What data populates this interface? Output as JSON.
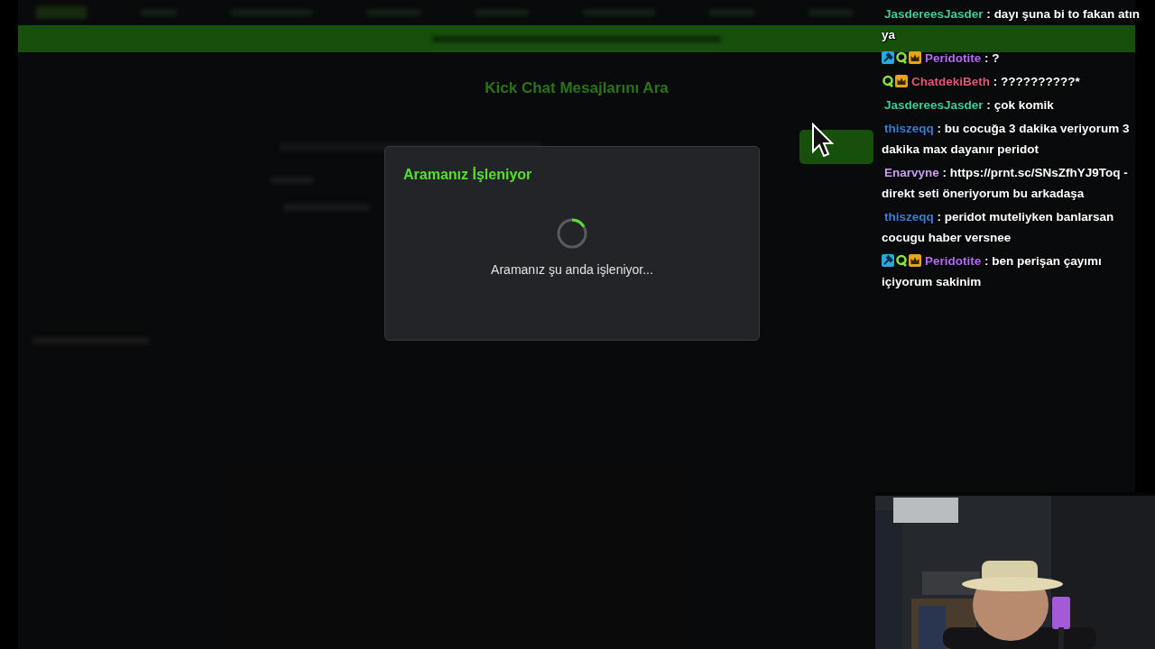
{
  "page": {
    "heading": "Kick Chat Mesajlarını Ara"
  },
  "modal": {
    "title": "Aramanız İşleniyor",
    "message": "Aramanız şu anda işleniyor..."
  },
  "chat": [
    {
      "user": "JasdereesJasder",
      "color": "#3fcf9c",
      "separator": ":",
      "text": "dayı şuna bi to fakan atın ya"
    },
    {
      "badges": [
        {
          "kind": "moderator"
        },
        {
          "kind": "vip"
        },
        {
          "kind": "subscriber"
        }
      ],
      "user": "Peridotite",
      "color": "#b46cf5",
      "separator": ":",
      "text": "?"
    },
    {
      "badges": [
        {
          "kind": "vip"
        },
        {
          "kind": "subscriber"
        }
      ],
      "user": "ChatdekiBeth",
      "color": "#e0587a",
      "separator": ":",
      "text": "??????????*"
    },
    {
      "user": "JasdereesJasder",
      "color": "#3fcf9c",
      "separator": ":",
      "text": "çok komik"
    },
    {
      "user": "thiszeqq",
      "color": "#3a7ed8",
      "separator": ":",
      "text": "bu cocuğa 3 dakika veriyorum 3 dakika max dayanır peridot"
    },
    {
      "user": "Enarvyne",
      "color": "#c9a2ee",
      "separator": ":",
      "text": "https://prnt.sc/SNsZfhYJ9Toq - direkt seti öneriyorum bu arkadaşa"
    },
    {
      "user": "thiszeqq",
      "color": "#3a7ed8",
      "separator": ":",
      "text": "peridot muteliyken banlarsan cocugu haber versnee"
    },
    {
      "badges": [
        {
          "kind": "moderator"
        },
        {
          "kind": "vip"
        },
        {
          "kind": "subscriber"
        }
      ],
      "user": "Peridotite",
      "color": "#b46cf5",
      "separator": ":",
      "text": "ben perişan çayımı içiyorum sakinim"
    }
  ]
}
